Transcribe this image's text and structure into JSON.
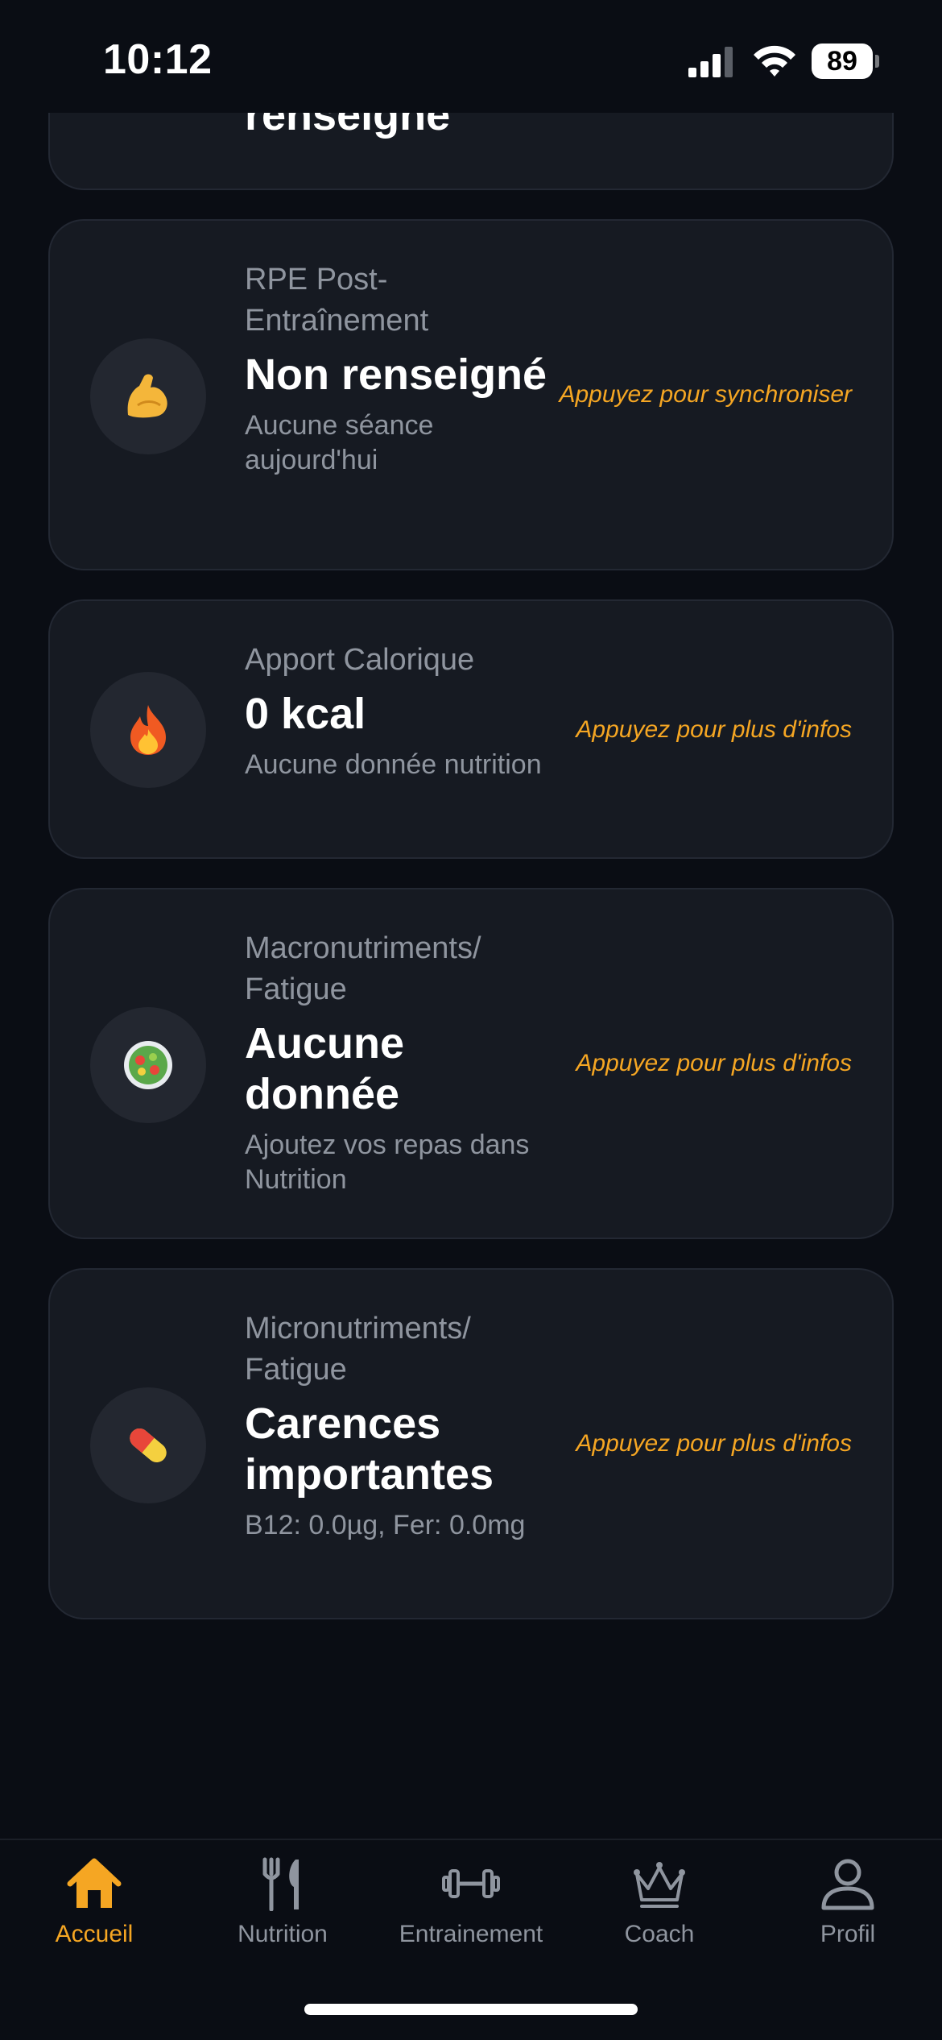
{
  "status_bar": {
    "time": "10:12",
    "battery": "89"
  },
  "top_card": {
    "value_tail": "renseigné"
  },
  "cards": [
    {
      "icon": "flexed-biceps-icon",
      "label": "RPE Post-Entraînement",
      "value": "Non renseigné",
      "sub": "Aucune séance aujourd'hui",
      "action": "Appuyez pour synchroniser"
    },
    {
      "icon": "fire-icon",
      "label": "Apport Calorique",
      "value": "0 kcal",
      "sub": "Aucune donnée nutrition",
      "action": "Appuyez pour plus d'infos"
    },
    {
      "icon": "salad-bowl-icon",
      "label": "Macronutriments/ Fatigue",
      "value": "Aucune donnée",
      "sub": "Ajoutez vos repas dans Nutrition",
      "action": "Appuyez pour plus d'infos"
    },
    {
      "icon": "pill-icon",
      "label": "Micronutriments/ Fatigue",
      "value": "Carences importantes",
      "sub": "B12: 0.0µg, Fer: 0.0mg",
      "action": "Appuyez pour plus d'infos"
    }
  ],
  "tab_bar": {
    "tabs": [
      {
        "label": "Accueil",
        "icon": "home-icon",
        "active": true
      },
      {
        "label": "Nutrition",
        "icon": "fork-knife-icon",
        "active": false
      },
      {
        "label": "Entrainement",
        "icon": "dumbbell-icon",
        "active": false
      },
      {
        "label": "Coach",
        "icon": "crown-icon",
        "active": false
      },
      {
        "label": "Profil",
        "icon": "person-icon",
        "active": false
      }
    ]
  },
  "colors": {
    "accent": "#f5a623",
    "background": "#0a0d14",
    "card": "#161a22",
    "muted_text": "#8f959f"
  }
}
